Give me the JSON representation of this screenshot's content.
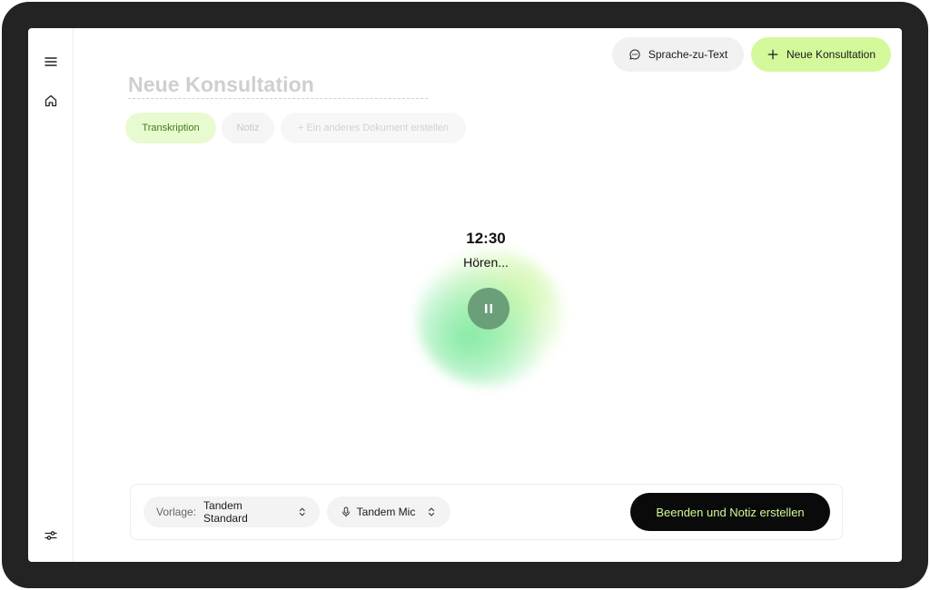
{
  "header": {
    "speech_to_text_label": "Sprache-zu-Text",
    "new_consultation_label": "Neue Konsultation"
  },
  "page": {
    "title": "Neue Konsultation"
  },
  "tabs": [
    {
      "label": "Transkription",
      "active": true
    },
    {
      "label": "Notiz",
      "active": false
    },
    {
      "label": "+ Ein anderes Dokument erstellen",
      "active": false
    }
  ],
  "recording": {
    "timer": "12:30",
    "status": "Hören..."
  },
  "bottom": {
    "template_label": "Vorlage:",
    "template_value": "Tandem Standard",
    "mic_value": "Tandem Mic",
    "finish_label": "Beenden und Notiz erstellen"
  },
  "colors": {
    "accent": "#d3f99a",
    "tab_active_bg": "#e8fad0",
    "tab_active_text": "#3f7d16",
    "pause_button": "#6b9f7a",
    "bezel": "#232323"
  },
  "icons": {
    "menu": "menu-icon",
    "home": "home-icon",
    "settings": "sliders-icon",
    "speech": "chat-bubble-icon",
    "plus": "plus-icon",
    "pause": "pause-icon",
    "microphone": "microphone-icon",
    "chevron": "chevron-up-down-icon"
  }
}
